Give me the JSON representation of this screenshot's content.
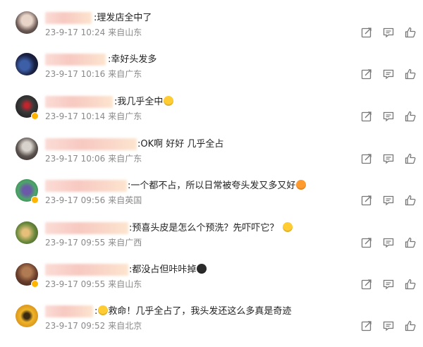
{
  "comments": [
    {
      "text": ":理发店全中了",
      "emoji": "",
      "date": "23-9-17 10:24",
      "location": "来自山东"
    },
    {
      "text": ":幸好头发多",
      "emoji": "",
      "date": "23-9-17 10:16",
      "location": "来自广东"
    },
    {
      "text": ":我几乎全中",
      "emoji": "laughing-emoji",
      "date": "23-9-17 10:14",
      "location": "来自广东"
    },
    {
      "text": ":OK啊 好好 几乎全占",
      "emoji": "",
      "date": "23-9-17 10:06",
      "location": "来自广东"
    },
    {
      "text": ":一个都不占，所以日常被夸头发又多又好",
      "emoji": "tongue-out-emoji",
      "date": "23-9-17 09:56",
      "location": "来自英国"
    },
    {
      "text": ":预喜头皮是怎么个预洗？先吓吓它？",
      "emoji": "thinking-emoji",
      "date": "23-9-17 09:55",
      "location": "来自广西"
    },
    {
      "text": ":都没占但咔咔掉",
      "emoji": "shocked-emoji",
      "date": "23-9-17 09:55",
      "location": "来自山东"
    },
    {
      "text": ":救命！几乎全占了，我头发还这么多真是奇迹",
      "emoji_prefix": "crying-emoji",
      "date": "23-9-17 09:52",
      "location": "来自北京"
    }
  ],
  "action_icons": [
    "share-icon",
    "comment-icon",
    "like-icon"
  ]
}
